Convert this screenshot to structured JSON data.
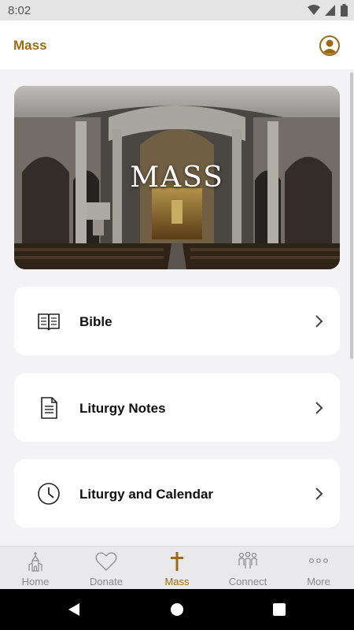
{
  "status_bar": {
    "time": "8:02"
  },
  "header": {
    "title": "Mass"
  },
  "hero": {
    "title": "MASS"
  },
  "menu": [
    {
      "label": "Bible",
      "icon": "book-icon"
    },
    {
      "label": "Liturgy Notes",
      "icon": "document-icon"
    },
    {
      "label": "Liturgy and Calendar",
      "icon": "clock-icon"
    }
  ],
  "bottom_nav": [
    {
      "label": "Home",
      "icon": "church-icon",
      "active": false
    },
    {
      "label": "Donate",
      "icon": "heart-icon",
      "active": false
    },
    {
      "label": "Mass",
      "icon": "cross-icon",
      "active": true
    },
    {
      "label": "Connect",
      "icon": "people-icon",
      "active": false
    },
    {
      "label": "More",
      "icon": "more-dots-icon",
      "active": false
    }
  ],
  "colors": {
    "accent": "#9a6b17",
    "background": "#f3f3f6",
    "card": "#ffffff",
    "nav_inactive": "#8a8a8d"
  }
}
